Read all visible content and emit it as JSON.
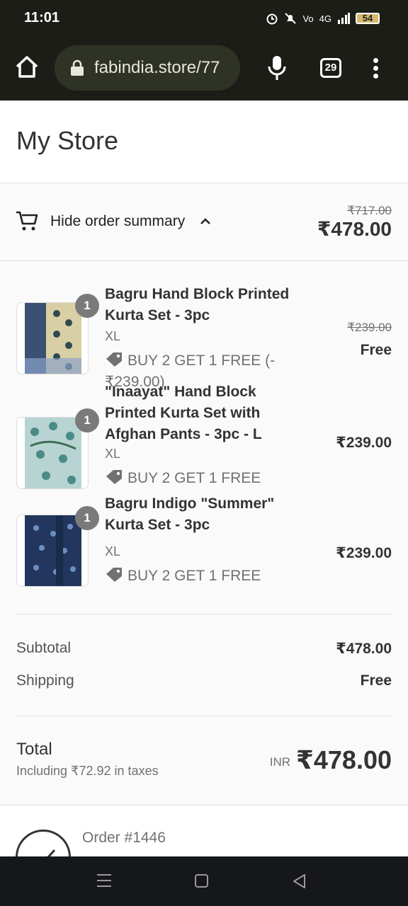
{
  "status_bar": {
    "time": "11:01",
    "network_label": "4G",
    "battery": "54"
  },
  "browser": {
    "url": "fabindia.store/77",
    "tab_count": "29"
  },
  "store": {
    "title": "My Store"
  },
  "order_summary": {
    "toggle_label": "Hide order summary",
    "original_total": "₹717.00",
    "total": "₹478.00"
  },
  "items": [
    {
      "name": "Bagru Hand Block Printed Kurta Set - 3pc",
      "quantity": "1",
      "variant": "XL",
      "promo": "BUY 2 GET 1 FREE (-₹239.00)",
      "price_original": "₹239.00",
      "price": "Free"
    },
    {
      "name": "\"Inaayat\" Hand Block Printed Kurta Set with Afghan Pants - 3pc - L",
      "quantity": "1",
      "variant": "XL",
      "promo": "BUY 2 GET 1 FREE",
      "price": "₹239.00"
    },
    {
      "name": "Bagru Indigo \"Summer\" Kurta Set - 3pc",
      "quantity": "1",
      "variant": "XL",
      "promo": "BUY 2 GET 1 FREE",
      "price": "₹239.00"
    }
  ],
  "totals": {
    "subtotal_label": "Subtotal",
    "subtotal_value": "₹478.00",
    "shipping_label": "Shipping",
    "shipping_value": "Free",
    "total_label": "Total",
    "tax_note": "Including ₹72.92 in taxes",
    "currency": "INR",
    "total_value": "₹478.00"
  },
  "order": {
    "number": "Order #1446"
  },
  "colors": {
    "browser_bar": "#1c1d17",
    "url_pill": "#2f3325",
    "summary_bg": "#fafafa",
    "quantity_badge": "#7a7a7a"
  },
  "icons": [
    "home-icon",
    "lock-icon",
    "mic-icon",
    "tabs-icon",
    "menu-icon",
    "cart-icon",
    "chevron-up-icon",
    "tag-icon",
    "check-circle-icon"
  ]
}
